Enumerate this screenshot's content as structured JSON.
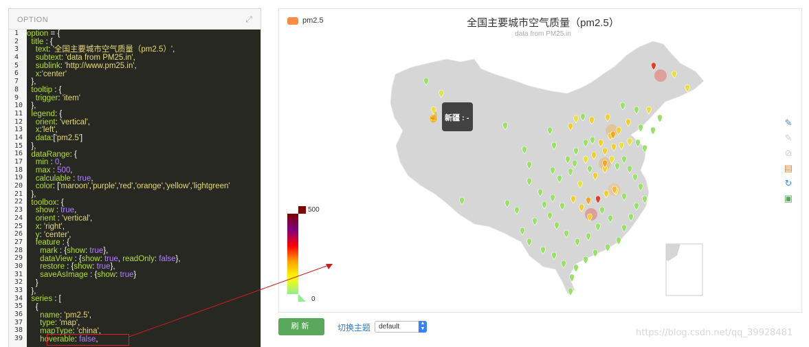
{
  "code_panel": {
    "title": "OPTION",
    "lines": [
      [
        [
          "k",
          "option"
        ],
        [
          "p",
          " = {"
        ]
      ],
      [
        [
          "p",
          "  "
        ],
        [
          "k",
          "title"
        ],
        [
          "p",
          " : {"
        ]
      ],
      [
        [
          "p",
          "    "
        ],
        [
          "k",
          "text"
        ],
        [
          "p",
          ": "
        ],
        [
          "s",
          "'全国主要城市空气质量（pm2.5）'"
        ],
        [
          "p",
          ","
        ]
      ],
      [
        [
          "p",
          "    "
        ],
        [
          "k",
          "subtext"
        ],
        [
          "p",
          ": "
        ],
        [
          "s",
          "'data from PM25.in'"
        ],
        [
          "p",
          ","
        ]
      ],
      [
        [
          "p",
          "    "
        ],
        [
          "k",
          "sublink"
        ],
        [
          "p",
          ": "
        ],
        [
          "s",
          "'http://www.pm25.in'"
        ],
        [
          "p",
          ","
        ]
      ],
      [
        [
          "p",
          "    "
        ],
        [
          "k",
          "x"
        ],
        [
          "p",
          ":"
        ],
        [
          "s",
          "'center'"
        ]
      ],
      [
        [
          "p",
          "  },"
        ]
      ],
      [
        [
          "p",
          "  "
        ],
        [
          "k",
          "tooltip"
        ],
        [
          "p",
          " : {"
        ]
      ],
      [
        [
          "p",
          "    "
        ],
        [
          "k",
          "trigger"
        ],
        [
          "p",
          ": "
        ],
        [
          "s",
          "'item'"
        ]
      ],
      [
        [
          "p",
          "  },"
        ]
      ],
      [
        [
          "p",
          "  "
        ],
        [
          "k",
          "legend"
        ],
        [
          "p",
          ": {"
        ]
      ],
      [
        [
          "p",
          "    "
        ],
        [
          "k",
          "orient"
        ],
        [
          "p",
          ": "
        ],
        [
          "s",
          "'vertical'"
        ],
        [
          "p",
          ","
        ]
      ],
      [
        [
          "p",
          "    "
        ],
        [
          "k",
          "x"
        ],
        [
          "p",
          ":"
        ],
        [
          "s",
          "'left'"
        ],
        [
          "p",
          ","
        ]
      ],
      [
        [
          "p",
          "    "
        ],
        [
          "k",
          "data"
        ],
        [
          "p",
          ":["
        ],
        [
          "s",
          "'pm2.5'"
        ],
        [
          "p",
          "]"
        ]
      ],
      [
        [
          "p",
          "  },"
        ]
      ],
      [
        [
          "p",
          "  "
        ],
        [
          "k",
          "dataRange"
        ],
        [
          "p",
          ": {"
        ]
      ],
      [
        [
          "p",
          "    "
        ],
        [
          "k",
          "min"
        ],
        [
          "p",
          " : "
        ],
        [
          "n",
          "0"
        ],
        [
          "p",
          ","
        ]
      ],
      [
        [
          "p",
          "    "
        ],
        [
          "k",
          "max"
        ],
        [
          "p",
          " : "
        ],
        [
          "n",
          "500"
        ],
        [
          "p",
          ","
        ]
      ],
      [
        [
          "p",
          "    "
        ],
        [
          "k",
          "calculable"
        ],
        [
          "p",
          " : "
        ],
        [
          "n",
          "true"
        ],
        [
          "p",
          ","
        ]
      ],
      [
        [
          "p",
          "    "
        ],
        [
          "k",
          "color"
        ],
        [
          "p",
          ": ["
        ],
        [
          "s",
          "'maroon'"
        ],
        [
          "p",
          ","
        ],
        [
          "s",
          "'purple'"
        ],
        [
          "p",
          ","
        ],
        [
          "s",
          "'red'"
        ],
        [
          "p",
          ","
        ],
        [
          "s",
          "'orange'"
        ],
        [
          "p",
          ","
        ],
        [
          "s",
          "'yellow'"
        ],
        [
          "p",
          ","
        ],
        [
          "s",
          "'lightgreen'"
        ]
      ],
      [
        [
          "p",
          "  },"
        ]
      ],
      [
        [
          "p",
          "  "
        ],
        [
          "k",
          "toolbox"
        ],
        [
          "p",
          ": {"
        ]
      ],
      [
        [
          "p",
          "    "
        ],
        [
          "k",
          "show"
        ],
        [
          "p",
          " : "
        ],
        [
          "n",
          "true"
        ],
        [
          "p",
          ","
        ]
      ],
      [
        [
          "p",
          "    "
        ],
        [
          "k",
          "orient"
        ],
        [
          "p",
          " : "
        ],
        [
          "s",
          "'vertical'"
        ],
        [
          "p",
          ","
        ]
      ],
      [
        [
          "p",
          "    "
        ],
        [
          "k",
          "x"
        ],
        [
          "p",
          ": "
        ],
        [
          "s",
          "'right'"
        ],
        [
          "p",
          ","
        ]
      ],
      [
        [
          "p",
          "    "
        ],
        [
          "k",
          "y"
        ],
        [
          "p",
          ": "
        ],
        [
          "s",
          "'center'"
        ],
        [
          "p",
          ","
        ]
      ],
      [
        [
          "p",
          "    "
        ],
        [
          "k",
          "feature"
        ],
        [
          "p",
          " : {"
        ]
      ],
      [
        [
          "p",
          "      "
        ],
        [
          "k",
          "mark"
        ],
        [
          "p",
          " : {"
        ],
        [
          "k",
          "show"
        ],
        [
          "p",
          ": "
        ],
        [
          "n",
          "true"
        ],
        [
          "p",
          "},"
        ]
      ],
      [
        [
          "p",
          "      "
        ],
        [
          "k",
          "dataView"
        ],
        [
          "p",
          " : {"
        ],
        [
          "k",
          "show"
        ],
        [
          "p",
          ": "
        ],
        [
          "n",
          "true"
        ],
        [
          "p",
          ", "
        ],
        [
          "k",
          "readOnly"
        ],
        [
          "p",
          ": "
        ],
        [
          "n",
          "false"
        ],
        [
          "p",
          "},"
        ]
      ],
      [
        [
          "p",
          "      "
        ],
        [
          "k",
          "restore"
        ],
        [
          "p",
          " : {"
        ],
        [
          "k",
          "show"
        ],
        [
          "p",
          ": "
        ],
        [
          "n",
          "true"
        ],
        [
          "p",
          "},"
        ]
      ],
      [
        [
          "p",
          "      "
        ],
        [
          "k",
          "saveAsImage"
        ],
        [
          "p",
          " : {"
        ],
        [
          "k",
          "show"
        ],
        [
          "p",
          ": "
        ],
        [
          "n",
          "true"
        ],
        [
          "p",
          "}"
        ]
      ],
      [
        [
          "p",
          "    }"
        ]
      ],
      [
        [
          "p",
          "  },"
        ]
      ],
      [
        [
          "p",
          "  "
        ],
        [
          "k",
          "series"
        ],
        [
          "p",
          " : ["
        ]
      ],
      [
        [
          "p",
          "    {"
        ]
      ],
      [
        [
          "p",
          "      "
        ],
        [
          "k",
          "name"
        ],
        [
          "p",
          ": "
        ],
        [
          "s",
          "'pm2.5'"
        ],
        [
          "p",
          ","
        ]
      ],
      [
        [
          "p",
          "      "
        ],
        [
          "k",
          "type"
        ],
        [
          "p",
          ": "
        ],
        [
          "s",
          "'map'"
        ],
        [
          "p",
          ","
        ]
      ],
      [
        [
          "p",
          "      "
        ],
        [
          "k",
          "mapType"
        ],
        [
          "p",
          ": "
        ],
        [
          "s",
          "'china'"
        ],
        [
          "p",
          ","
        ]
      ],
      [
        [
          "p",
          "      "
        ],
        [
          "k",
          "hoverable"
        ],
        [
          "p",
          ": "
        ],
        [
          "n",
          "false"
        ],
        [
          "p",
          ","
        ]
      ]
    ]
  },
  "chart": {
    "legend_label": "pm2.5",
    "title": "全国主要城市空气质量（pm2.5）",
    "subtitle": "data from PM25.in",
    "tooltip_text": "新疆 : -",
    "range_max": "500",
    "range_min": "0",
    "range_colors": [
      "#800000",
      "#800080",
      "#ff0000",
      "#ffa500",
      "#ffff00",
      "#90ee90"
    ],
    "marker_color_high": "#e83a2a",
    "marker_color_mid": "#f5a623",
    "marker_color_low": "#9be06a",
    "toolbox": [
      {
        "name": "mark",
        "icon": "pencil-icon",
        "color": "#4a90e2"
      },
      {
        "name": "mark-undo",
        "icon": "eraser-icon",
        "color": "#cfcfcf"
      },
      {
        "name": "mark-clear",
        "icon": "trash-icon",
        "color": "#cfcfcf"
      },
      {
        "name": "dataView",
        "icon": "document-icon",
        "color": "#e0883a"
      },
      {
        "name": "restore",
        "icon": "refresh-icon",
        "color": "#3a8ee6"
      },
      {
        "name": "saveAsImage",
        "icon": "save-icon",
        "color": "#5aa85c"
      }
    ]
  },
  "controls": {
    "refresh_label": "刷新",
    "theme_label": "切换主题",
    "theme_value": "default"
  },
  "watermark": "https://blog.csdn.net/qq_39928481"
}
